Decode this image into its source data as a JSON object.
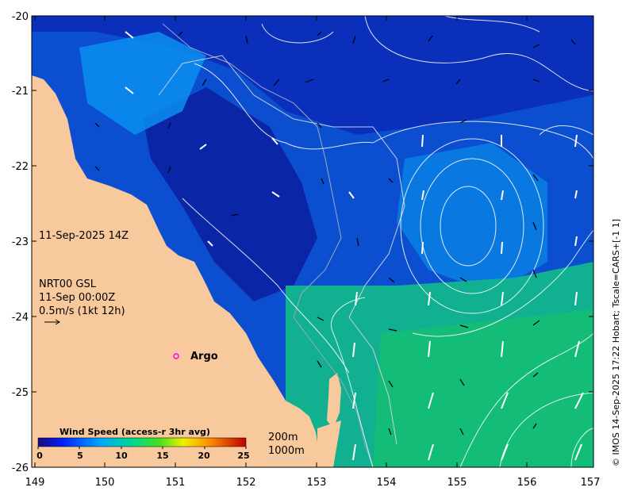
{
  "axes": {
    "lon_ticks": [
      "149",
      "150",
      "151",
      "152",
      "153",
      "154",
      "155",
      "156",
      "157"
    ],
    "lat_ticks": [
      "-20",
      "-21",
      "-22",
      "-23",
      "-24",
      "-25",
      "-26"
    ],
    "lon_range": [
      149,
      157
    ],
    "lat_range": [
      -26,
      -20
    ]
  },
  "labels": {
    "date": "11-Sep-2025 14Z",
    "product": "NRT00 GSL",
    "time": "11-Sep 00:00Z",
    "scale": "0.5m/s (1kt 12h)",
    "argo": "Argo",
    "credit": "© IMOS 14-Sep-2025 17:22 Hobart; Tscale=CARS+[-1 1]"
  },
  "colorbar": {
    "title": "Wind Speed (access-r 3hr avg)",
    "ticks": [
      "0",
      "5",
      "10",
      "15",
      "20",
      "25"
    ],
    "range": [
      0,
      25
    ]
  },
  "depth_legend": {
    "line1": "200m",
    "line2": "1000m"
  },
  "colors": {
    "land": "#f8c99c",
    "ocean_dark": "#0a1fa8",
    "ocean_mid": "#0b6fe0",
    "ocean_green": "#12b87a",
    "argo": "#ff00ff"
  },
  "argo_position": {
    "lon": 150.99,
    "lat": -24.53
  }
}
